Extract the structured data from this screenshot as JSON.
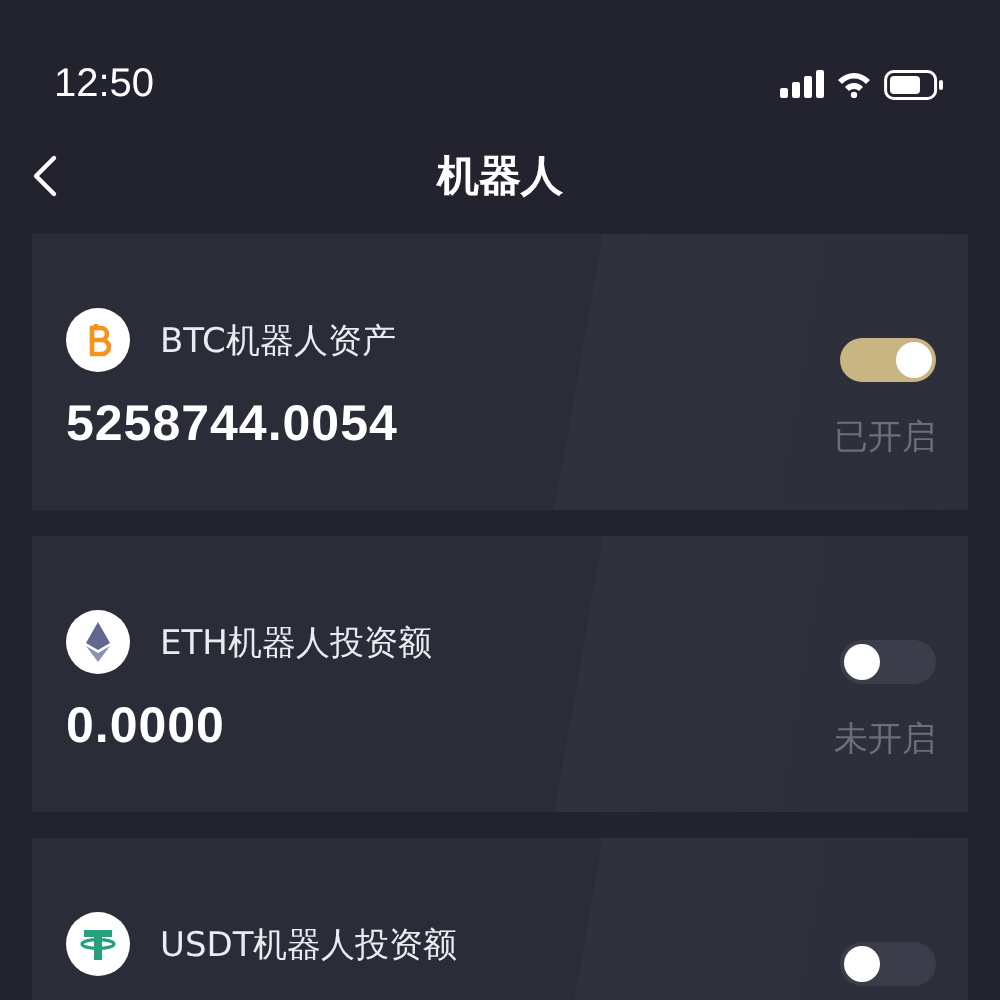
{
  "status_bar": {
    "time": "12:50"
  },
  "nav": {
    "title": "机器人"
  },
  "robots": [
    {
      "kind": "btc",
      "title": "BTC机器人资产",
      "amount": "5258744.0054",
      "on": true,
      "status": "已开启"
    },
    {
      "kind": "eth",
      "title": "ETH机器人投资额",
      "amount": "0.0000",
      "on": false,
      "status": "未开启"
    },
    {
      "kind": "usdt",
      "title": "USDT机器人投资额",
      "on": false
    }
  ]
}
